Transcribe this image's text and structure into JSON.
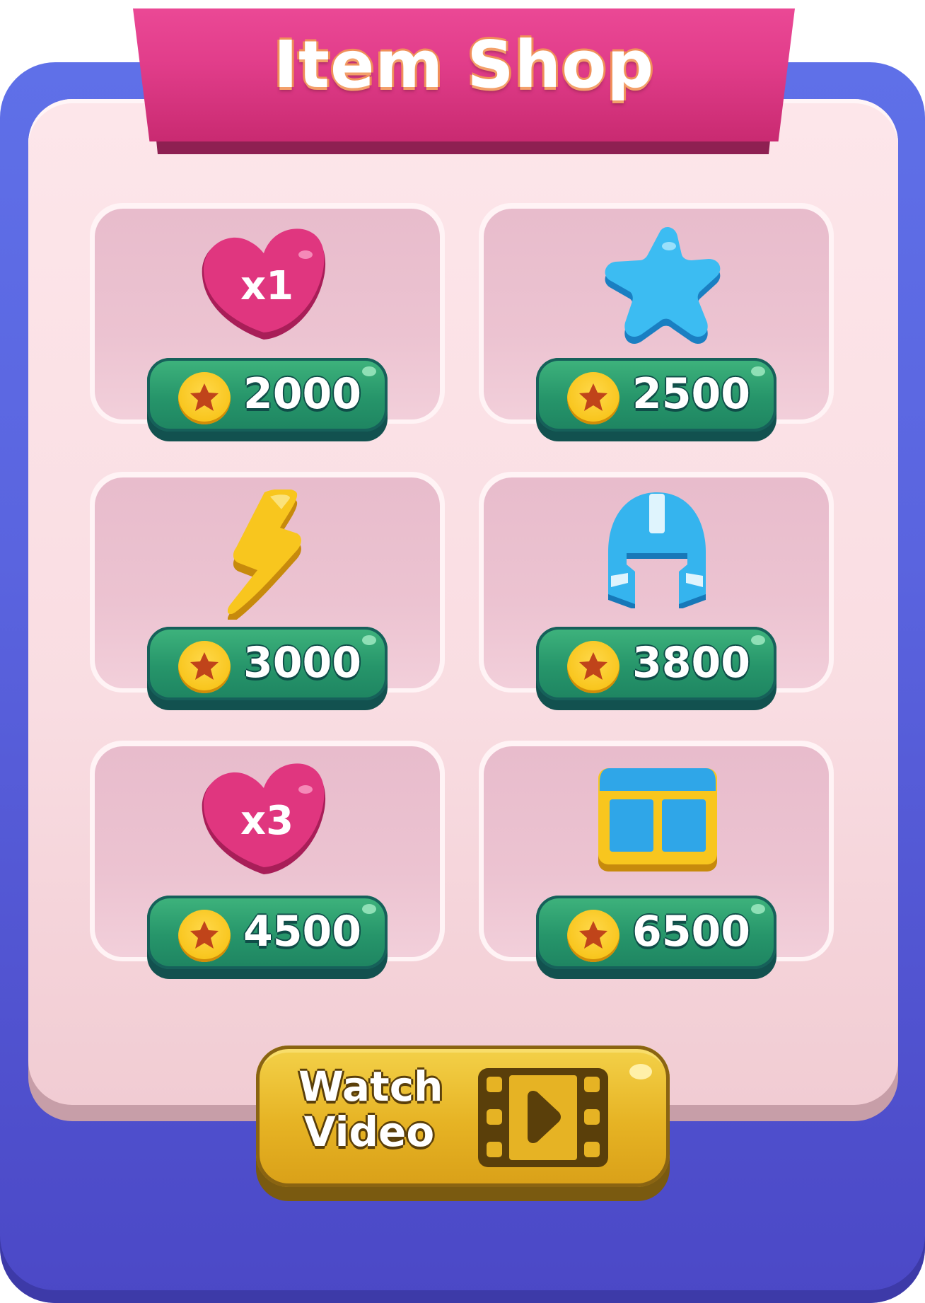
{
  "title": "Item Shop",
  "currency_icon": "star-coin-icon",
  "items": [
    {
      "icon": "heart-icon",
      "badge": "x1",
      "price": "2000"
    },
    {
      "icon": "star-icon",
      "badge": "",
      "price": "2500"
    },
    {
      "icon": "lightning-icon",
      "badge": "",
      "price": "3000"
    },
    {
      "icon": "helmet-icon",
      "badge": "",
      "price": "3800"
    },
    {
      "icon": "heart-icon",
      "badge": "x3",
      "price": "4500"
    },
    {
      "icon": "treasure-chest-icon",
      "badge": "",
      "price": "6500"
    }
  ],
  "watch_video": {
    "line1": "Watch",
    "line2": "Video",
    "icon": "film-play-icon"
  },
  "colors": {
    "frame": "#5a64df",
    "panel": "#fbe1e6",
    "banner": "#e13d8a",
    "price_button": "#26956a",
    "watch_button": "#e6b324"
  }
}
